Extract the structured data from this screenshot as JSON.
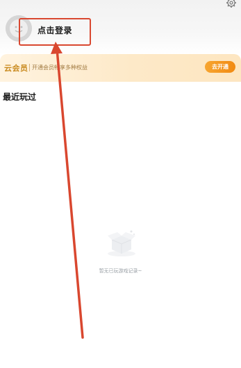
{
  "header": {
    "login_label": "点击登录",
    "settings_icon": "gear-icon",
    "avatar_icon": "default-avatar-icon"
  },
  "vip": {
    "title": "云会员",
    "description": "开通会员畅享多种权益",
    "button_label": "去开通"
  },
  "recent": {
    "title": "最近玩过",
    "empty_text": "暂无已玩游戏记录~",
    "empty_icon": "empty-box-icon"
  },
  "annotation": {
    "color": "#d9472f"
  }
}
